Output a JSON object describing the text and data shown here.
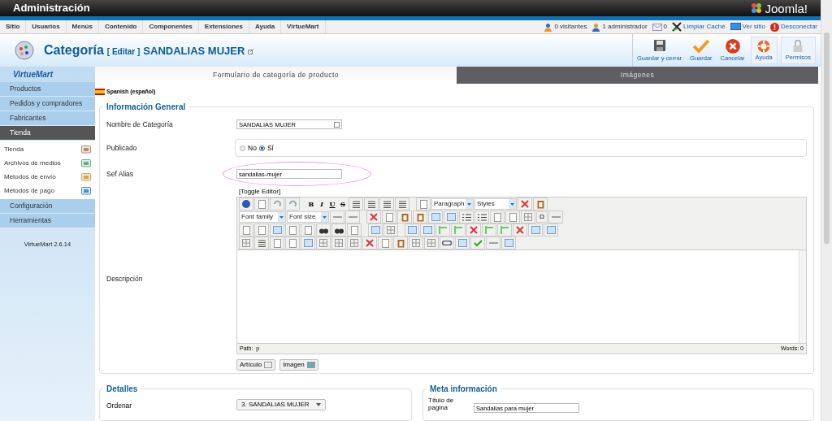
{
  "top_bar": {
    "title": "Administración",
    "logo": "Joomla!"
  },
  "menu": [
    {
      "label": "Sitio"
    },
    {
      "label": "Usuarios"
    },
    {
      "label": "Menús"
    },
    {
      "label": "Contenido"
    },
    {
      "label": "Componentes"
    },
    {
      "label": "Extensiones"
    },
    {
      "label": "Ayuda"
    },
    {
      "label": "VirtueMart"
    }
  ],
  "status": [
    {
      "kind": "users",
      "label": "0 visitantes"
    },
    {
      "kind": "admin",
      "label": "1 administrador"
    },
    {
      "kind": "mail",
      "label": "0"
    },
    {
      "kind": "cache",
      "label": "Limpiar Caché"
    },
    {
      "kind": "site",
      "label": "Ver sitio"
    },
    {
      "kind": "logout",
      "label": "Desconectar"
    }
  ],
  "header": {
    "title": "Categoría",
    "edit": "[ Editar ]",
    "name": "SANDALIAS MUJER"
  },
  "actions": [
    {
      "kind": "save-close",
      "label": "Guardar y cerrar"
    },
    {
      "kind": "save",
      "label": "Guardar"
    },
    {
      "kind": "cancel",
      "label": "Cancelar"
    },
    {
      "kind": "help",
      "label": "Ayuda"
    },
    {
      "kind": "permissions",
      "label": "Permisos"
    }
  ],
  "sidebar": {
    "logo": "VirtueMart",
    "items": [
      {
        "label": "Productos",
        "selected": false
      },
      {
        "label": "Pedidos y compradores",
        "selected": false
      },
      {
        "label": "Fabricantes",
        "selected": false
      },
      {
        "label": "Tienda",
        "selected": true,
        "expanded": true,
        "children": [
          {
            "kind": "store",
            "label": "Tienda"
          },
          {
            "kind": "media",
            "label": "Archivos de medios"
          },
          {
            "kind": "shipping",
            "label": "Métodos de envío"
          },
          {
            "kind": "payment",
            "label": "Métodos de pago"
          }
        ]
      },
      {
        "label": "Configuración",
        "selected": false
      },
      {
        "label": "Herramientas",
        "selected": false
      }
    ],
    "version": "VirtueMart 2.6.14"
  },
  "tabs": [
    {
      "label": "Formulario de categoría de producto",
      "selected": true
    },
    {
      "label": "Imágenes",
      "selected": false
    }
  ],
  "language": "Spanish (español)",
  "general": {
    "legend": "Información General",
    "name_label": "Nombre de Categoría",
    "name_value": "SANDALIAS MUJER",
    "published_label": "Publicado",
    "options": [
      {
        "label": "No",
        "selected": false
      },
      {
        "label": "Sí",
        "selected": true
      }
    ],
    "alias_label": "Sef Alias",
    "alias_value": "sandalias-mujer",
    "description_label": "Descripción",
    "toggle": "[Toggle Editor]",
    "format_letters": [
      "B",
      "I",
      "U",
      "S"
    ],
    "paragraph": "Paragraph",
    "styles": "Styles",
    "font_family": "Font family",
    "font_size": "Font size",
    "omega": "Ω",
    "path_label": "Path:",
    "path_value": "p",
    "words": "Words: 0",
    "buttons": [
      {
        "kind": "article",
        "label": "Artículo"
      },
      {
        "kind": "image",
        "label": "Imagen"
      }
    ]
  },
  "details": {
    "legend": "Detalles",
    "order_label": "Ordenar",
    "order_value": "3. SANDALIAS MUJER"
  },
  "meta": {
    "legend": "Meta información",
    "title_label": "Título de pagina",
    "title_value": "Sandalias para mujer"
  }
}
